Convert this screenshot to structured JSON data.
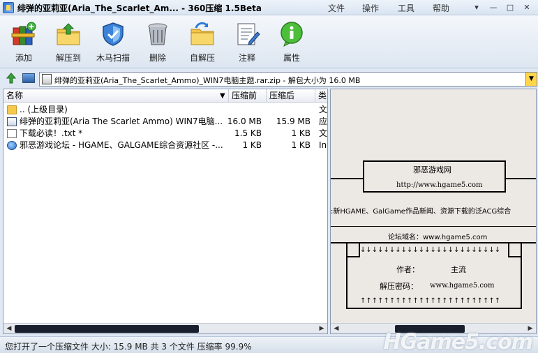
{
  "titlebar": {
    "title": "绯弹的亚莉亚(Aria_The_Scarlet_Am... - 360压缩 1.5Beta",
    "menus": [
      "文件",
      "操作",
      "工具",
      "帮助"
    ],
    "buttons": [
      "▾",
      "—",
      "□",
      "✕"
    ]
  },
  "toolbar": {
    "items": [
      {
        "label": "添加",
        "icon": "add-books-icon"
      },
      {
        "label": "解压到",
        "icon": "extract-folder-icon"
      },
      {
        "label": "木马扫描",
        "icon": "shield-icon"
      },
      {
        "label": "删除",
        "icon": "trash-icon"
      },
      {
        "label": "自解压",
        "icon": "self-extract-icon"
      },
      {
        "label": "注释",
        "icon": "comment-icon"
      },
      {
        "label": "属性",
        "icon": "info-icon"
      }
    ]
  },
  "addressbar": {
    "path": "绯弹的亚莉亚(Aria_The_Scarlet_Ammo)_WIN7电脑主题.rar.zip - 解包大小为 16.0 MB"
  },
  "filelist": {
    "headers": {
      "name": "名称",
      "sort_arrow": "▼",
      "compressed": "压缩前",
      "packed": "压缩后",
      "type": "类"
    },
    "rows": [
      {
        "name": ".. (上级目录)",
        "compressed": "",
        "packed": "",
        "type": "文",
        "icon": "folder-icon"
      },
      {
        "name": "绯弹的亚莉亚(Aria The Scarlet Ammo) WIN7电脑...",
        "compressed": "16.0 MB",
        "packed": "15.9 MB",
        "type": "应",
        "icon": "rar-file-icon"
      },
      {
        "name": "下载必读！.txt *",
        "compressed": "1.5 KB",
        "packed": "1 KB",
        "type": "文",
        "icon": "text-file-icon"
      },
      {
        "name": "邪恶游戏论坛 - HGAME、GALGAME综合资源社区 -...",
        "compressed": "1 KB",
        "packed": "1 KB",
        "type": "In",
        "icon": "ie-link-icon"
      }
    ]
  },
  "preview": {
    "site_title": "邪恶游戏网",
    "site_url": "http://www.hgame5.com",
    "tagline": ":新HGAME、GalGame作品新闻、资源下载的泛ACG综合",
    "forum_label": "论坛域名：www.hgame5.com",
    "down_arrows": "↓↓↓↓↓↓↓↓↓↓↓↓↓↓↓↓↓↓↓↓↓↓↓↓",
    "author_label": "作者：",
    "author_value": "主流",
    "password_label": "解压密码：",
    "password_value": "www.hgame5.com",
    "up_arrows": "↑↑↑↑↑↑↑↑↑↑↑↑↑↑↑↑↑↑↑↑↑↑↑↑"
  },
  "statusbar": {
    "text": "您打开了一个压缩文件 大小: 15.9 MB 共 3 个文件 压缩率 99.9%",
    "watermark": "HGame5.com"
  }
}
